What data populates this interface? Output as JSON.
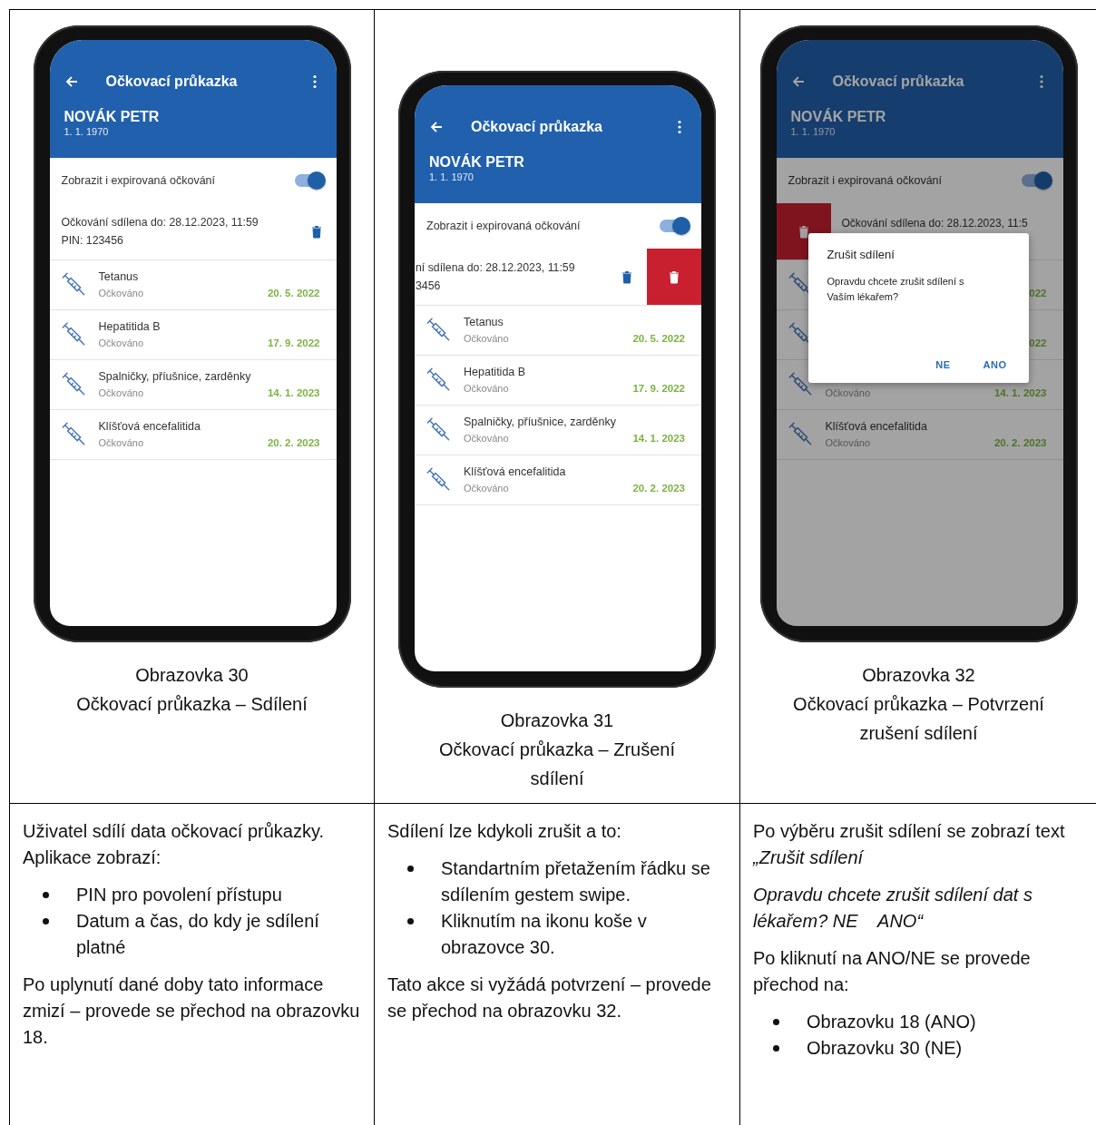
{
  "columns": [
    {
      "phone": {
        "kind": "normal",
        "app_title": "Očkovací průkazka",
        "patient_name": "NOVÁK PETR",
        "birth_date": "1. 1. 1970",
        "toggle": {
          "label": "Zobrazit i expirovaná očkování",
          "on": true
        },
        "share_lines": [
          "Očkování sdílena do: 28.12.2023, 11:59",
          "PIN: 123456"
        ],
        "vaccinations": [
          {
            "name": "Tetanus",
            "status": "Očkováno",
            "date": "20. 5. 2022"
          },
          {
            "name": "Hepatitida B",
            "status": "Očkováno",
            "date": "17. 9. 2022"
          },
          {
            "name": "Spalničky, příušnice, zarděnky",
            "status": "Očkováno",
            "date": "14. 1. 2023"
          },
          {
            "name": "Klíšťová encefalitida",
            "status": "Očkováno",
            "date": "20. 2. 2023"
          }
        ]
      },
      "caption": {
        "number": "Obrazovka 30",
        "title": "Očkovací průkazka – Sdílení"
      },
      "description": [
        {
          "kind": "paragraph",
          "text": "Uživatel sdílí data očkovací průkazky. Aplikace zobrazí:"
        },
        {
          "kind": "bullets",
          "items": [
            "PIN pro povolení přístupu",
            "Datum a čas, do kdy je sdílení platné"
          ]
        },
        {
          "kind": "paragraph",
          "text": "Po uplynutí dané doby tato informace zmizí – provede se přechod na obrazovku 18."
        }
      ]
    },
    {
      "phone": {
        "kind": "swiped",
        "app_title": "Očkovací průkazka",
        "patient_name": "NOVÁK PETR",
        "birth_date": "1. 1. 1970",
        "toggle": {
          "label": "Zobrazit i expirovaná očkování",
          "on": true
        },
        "share_lines": [
          "ní sdílena do: 28.12.2023, 11:59",
          "3456"
        ],
        "vaccinations": [
          {
            "name": "Tetanus",
            "status": "Očkováno",
            "date": "20. 5. 2022"
          },
          {
            "name": "Hepatitida B",
            "status": "Očkováno",
            "date": "17. 9. 2022"
          },
          {
            "name": "Spalničky, příušnice, zarděnky",
            "status": "Očkováno",
            "date": "14. 1. 2023"
          },
          {
            "name": "Klíšťová encefalitida",
            "status": "Očkováno",
            "date": "20. 2. 2023"
          }
        ]
      },
      "caption": {
        "number": "Obrazovka 31",
        "title": "Očkovací průkazka – Zrušení sdílení"
      },
      "description": [
        {
          "kind": "paragraph",
          "text": "Sdílení lze kdykoli zrušit a to:"
        },
        {
          "kind": "bullets",
          "items": [
            "Standartním přetažením řádku se sdílením gestem swipe.",
            "Kliknutím na ikonu koše v obrazovce 30."
          ]
        },
        {
          "kind": "paragraph",
          "text": "Tato akce si vyžádá potvrzení – provede se přechod na obrazovku 32."
        }
      ]
    },
    {
      "phone": {
        "kind": "dialog",
        "app_title": "Očkovací průkazka",
        "patient_name": "NOVÁK PETR",
        "birth_date": "1. 1. 1970",
        "toggle": {
          "label": "Zobrazit i expirovaná očkování",
          "on": true
        },
        "share_lines": [
          "Očkování sdílena do: 28.12.2023, 11:5"
        ],
        "vaccinations": [
          {
            "date": "022"
          },
          {
            "date": "022"
          },
          {
            "status": "Očkováno",
            "date": "14. 1. 2023"
          },
          {
            "name": "Klíšťová encefalitida",
            "status": "Očkováno",
            "date": "20. 2. 2023"
          }
        ],
        "dialog": {
          "title": "Zrušit sdílení",
          "message": "Opravdu chcete zrušit sdílení s Vaším lékařem?",
          "buttons": [
            "NE",
            "ANO"
          ]
        }
      },
      "caption": {
        "number": "Obrazovka 32",
        "title": "Očkovací průkazka – Potvrzení zrušení sdílení"
      },
      "description": [
        {
          "kind": "paragraph",
          "text": "Po výběru zrušit sdílení se zobrazí text *„Zrušit sdílení*"
        },
        {
          "kind": "italic_paragraph",
          "text": "Opravdu chcete zrušit sdílení dat s lékařem? NE    ANO“"
        },
        {
          "kind": "paragraph",
          "text": "Po kliknutí na ANO/NE se provede přechod na:"
        },
        {
          "kind": "bullets",
          "items": [
            "Obrazovku 18 (ANO)",
            "Obrazovku 30 (NE)"
          ]
        }
      ]
    }
  ]
}
